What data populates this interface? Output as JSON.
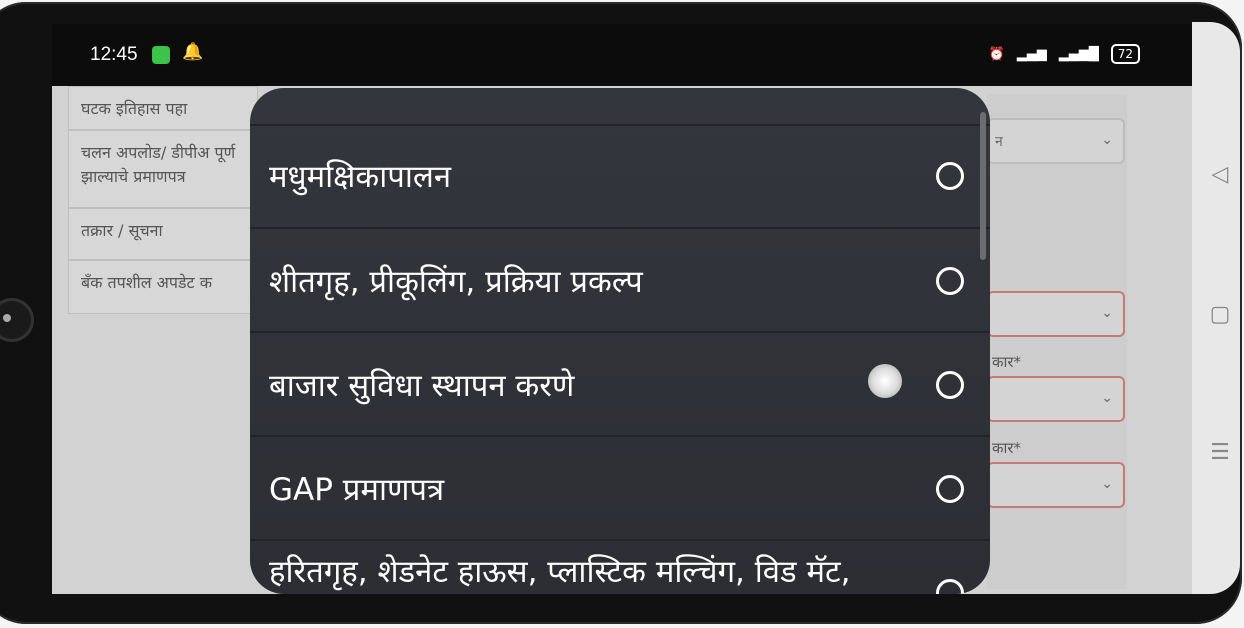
{
  "status_bar": {
    "time": "12:45",
    "battery": "72"
  },
  "background": {
    "menu": [
      "घटक इतिहास पहा",
      "चलन अपलोड/ डीपीअ पूर्ण झाल्याचे प्रमाणपत्र",
      "तक्रार / सूचना",
      "बँक तपशील अपडेट क"
    ],
    "selects": [
      "न",
      "",
      "",
      ""
    ],
    "labels": [
      "कार*",
      "कार*"
    ]
  },
  "dialog": {
    "options": [
      {
        "label": "मधुमक्षिकापालन",
        "selected": false
      },
      {
        "label": "शीतगृह, प्रीकूलिंग, प्रक्रिया प्रकल्प",
        "selected": false
      },
      {
        "label": "बाजार सुविधा स्थापन करणे",
        "selected": false
      },
      {
        "label": "GAP प्रमाणपत्र",
        "selected": false
      },
      {
        "label": "हरितगृह, शेडनेट हाऊस, प्लास्टिक मल्चिंग, विड मॅट,",
        "selected": false
      }
    ]
  },
  "nav_icons": [
    "back-icon",
    "home-icon",
    "menu-icon"
  ]
}
